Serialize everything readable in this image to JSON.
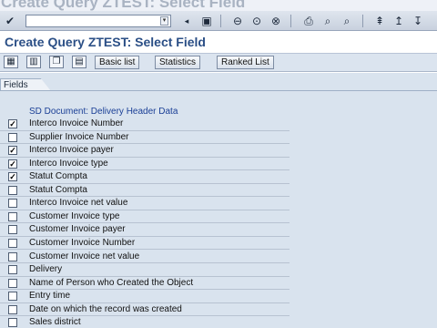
{
  "window": {
    "title": "Create Query ZTEST: Select Field"
  },
  "system_toolbar": {
    "enter_icon": "check-icon",
    "command_field": {
      "value": "",
      "placeholder": ""
    }
  },
  "screen": {
    "title": "Create Query ZTEST: Select Field"
  },
  "app_toolbar": {
    "buttons": [
      {
        "label": "Basic list"
      },
      {
        "label": "Statistics"
      },
      {
        "label": "Ranked List"
      }
    ]
  },
  "fields_tab": {
    "label": "Fields"
  },
  "group": {
    "title": "SD Document: Delivery Header Data"
  },
  "fields": [
    {
      "label": "Interco Invoice Number",
      "checked": true
    },
    {
      "label": "Supplier Invoice Number",
      "checked": false
    },
    {
      "label": "Interco Invoice payer",
      "checked": true
    },
    {
      "label": "Interco Invoice type",
      "checked": true
    },
    {
      "label": "Statut Compta",
      "checked": true
    },
    {
      "label": "Statut Compta",
      "checked": false
    },
    {
      "label": "Interco Invoice net value",
      "checked": false
    },
    {
      "label": "Customer Invoice type",
      "checked": false
    },
    {
      "label": "Customer Invoice payer",
      "checked": false
    },
    {
      "label": "Customer Invoice Number",
      "checked": false
    },
    {
      "label": "Customer Invoice net value",
      "checked": false
    },
    {
      "label": "Delivery",
      "checked": false
    },
    {
      "label": "Name of Person who Created the Object",
      "checked": false
    },
    {
      "label": "Entry time",
      "checked": false
    },
    {
      "label": "Date on which the record was created",
      "checked": false
    },
    {
      "label": "Sales district",
      "checked": false
    }
  ]
}
